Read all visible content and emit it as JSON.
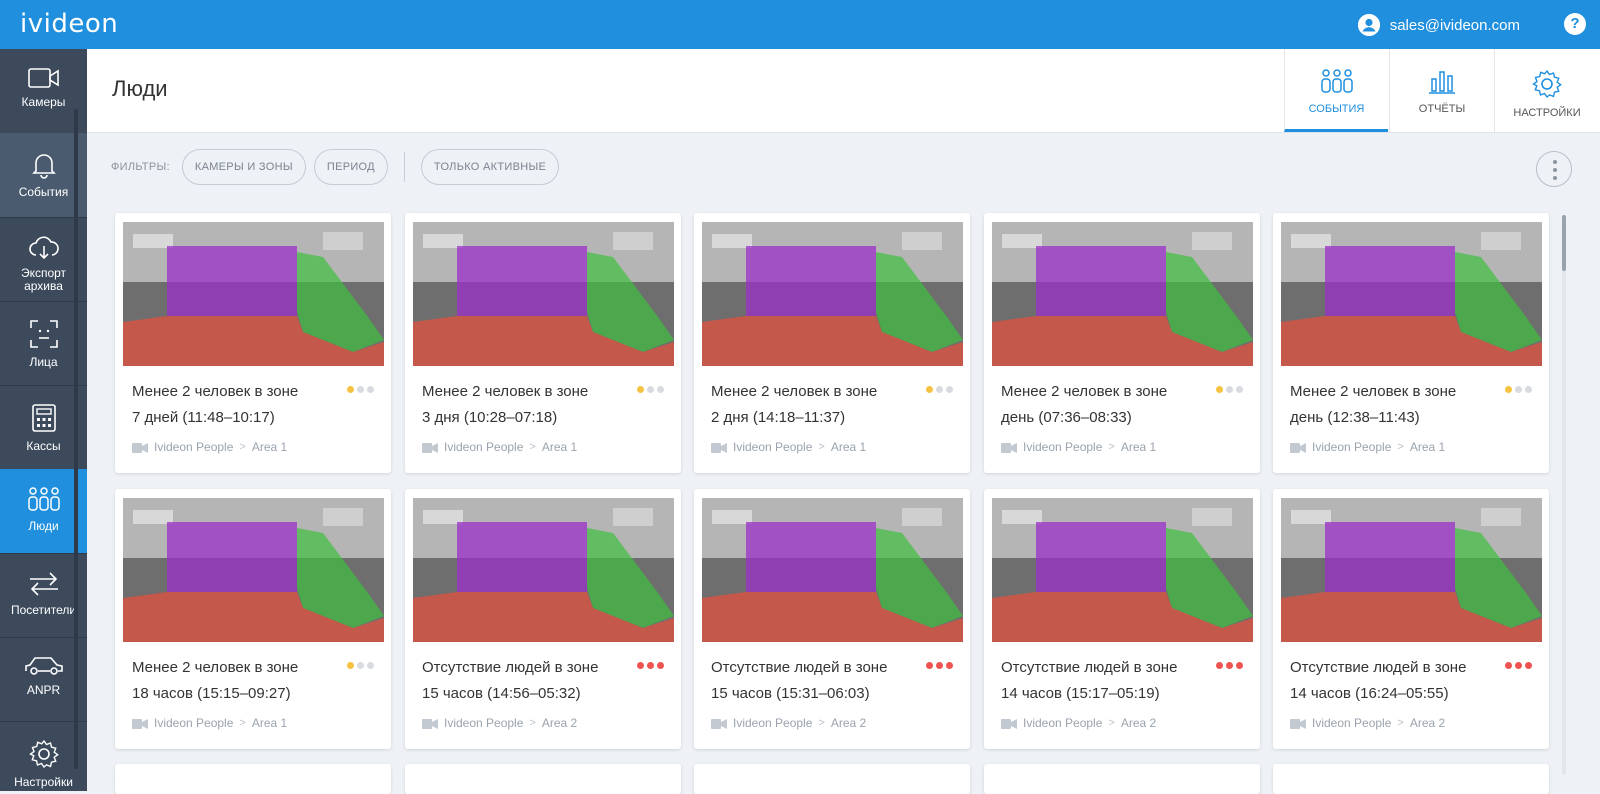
{
  "app": {
    "logo": "ivideon",
    "user_email": "sales@ivideon.com",
    "help": "?"
  },
  "sidebar": {
    "items": [
      {
        "label": "Камеры",
        "icon": "camera-icon"
      },
      {
        "label": "События",
        "icon": "bell-icon"
      },
      {
        "label": "Экспорт архива",
        "icon": "cloud-download-icon"
      },
      {
        "label": "Лица",
        "icon": "face-scan-icon"
      },
      {
        "label": "Кассы",
        "icon": "cash-register-icon"
      },
      {
        "label": "Люди",
        "icon": "people-icon"
      },
      {
        "label": "Посетители",
        "icon": "arrows-icon"
      },
      {
        "label": "ANPR",
        "icon": "car-icon"
      },
      {
        "label": "Настройки",
        "icon": "gear-icon"
      }
    ]
  },
  "page": {
    "title": "Люди"
  },
  "header_tabs": [
    {
      "label": "СОБЫТИЯ",
      "icon": "people-icon"
    },
    {
      "label": "ОТЧЁТЫ",
      "icon": "chart-icon"
    },
    {
      "label": "НАСТРОЙКИ",
      "icon": "gear-icon"
    }
  ],
  "filters": {
    "label": "ФИЛЬТРЫ:",
    "cameras": "КАМЕРЫ И ЗОНЫ",
    "period": "ПЕРИОД",
    "active_only": "ТОЛЬКО АКТИВНЫЕ"
  },
  "colors": {
    "accent": "#1f8fde",
    "sidebar": "#3c4a5c",
    "yellow": "#f5c242",
    "red": "#ef5350",
    "grey": "#d7dbe0",
    "zone_purple": "#9b30c8",
    "zone_green": "#3fbf3f",
    "zone_red": "#e8503c"
  },
  "cards": [
    {
      "title": "Менее 2 человек в зоне",
      "duration": "7 дней (11:48–10:17)",
      "camera": "Ivideon People",
      "area": "Area 1",
      "severity": "low"
    },
    {
      "title": "Менее 2 человек в зоне",
      "duration": "3 дня (10:28–07:18)",
      "camera": "Ivideon People",
      "area": "Area 1",
      "severity": "low"
    },
    {
      "title": "Менее 2 человек в зоне",
      "duration": "2 дня (14:18–11:37)",
      "camera": "Ivideon People",
      "area": "Area 1",
      "severity": "low"
    },
    {
      "title": "Менее 2 человек в зоне",
      "duration": "день (07:36–08:33)",
      "camera": "Ivideon People",
      "area": "Area 1",
      "severity": "low"
    },
    {
      "title": "Менее 2 человек в зоне",
      "duration": "день (12:38–11:43)",
      "camera": "Ivideon People",
      "area": "Area 1",
      "severity": "low"
    },
    {
      "title": "Менее 2 человек в зоне",
      "duration": "18 часов (15:15–09:27)",
      "camera": "Ivideon People",
      "area": "Area 1",
      "severity": "low"
    },
    {
      "title": "Отсутствие людей в зоне",
      "duration": "15 часов (14:56–05:32)",
      "camera": "Ivideon People",
      "area": "Area 2",
      "severity": "high"
    },
    {
      "title": "Отсутствие людей в зоне",
      "duration": "15 часов (15:31–06:03)",
      "camera": "Ivideon People",
      "area": "Area 2",
      "severity": "high"
    },
    {
      "title": "Отсутствие людей в зоне",
      "duration": "14 часов (15:17–05:19)",
      "camera": "Ivideon People",
      "area": "Area 2",
      "severity": "high"
    },
    {
      "title": "Отсутствие людей в зоне",
      "duration": "14 часов (16:24–05:55)",
      "camera": "Ivideon People",
      "area": "Area 2",
      "severity": "high"
    }
  ]
}
